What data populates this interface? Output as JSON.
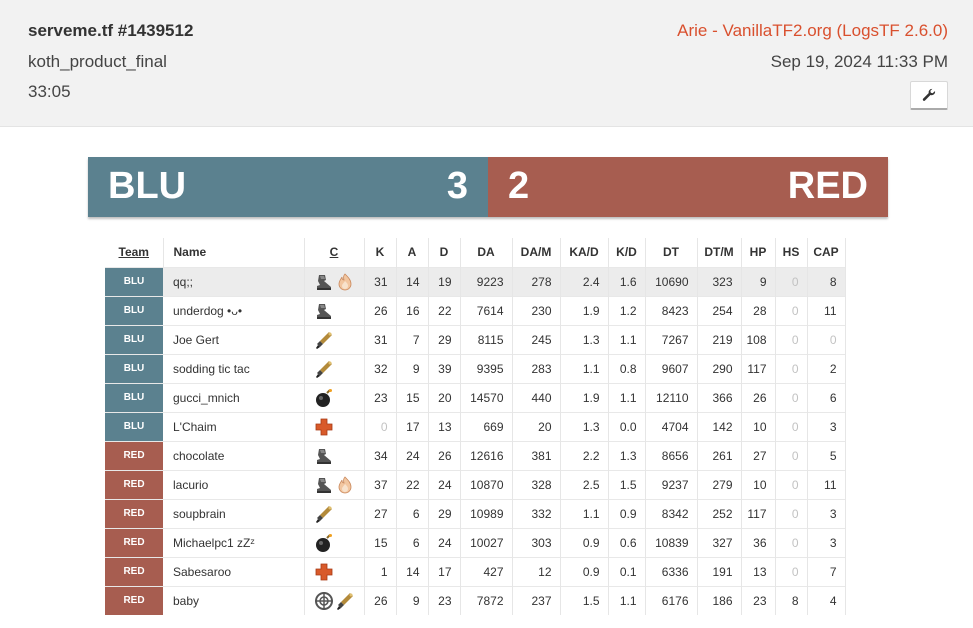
{
  "header": {
    "title": "serveme.tf #1439512",
    "map": "koth_product_final",
    "duration": "33:05",
    "uploader": "Arie - VanillaTF2.org (LogsTF 2.6.0)",
    "date": "Sep 19, 2024 11:33 PM",
    "tool_icon": "wrench-icon"
  },
  "score": {
    "blu_label": "BLU",
    "blu_score": "3",
    "red_score": "2",
    "red_label": "RED",
    "colors": {
      "blu": "#5b818f",
      "red": "#a75d50"
    }
  },
  "table": {
    "headers": [
      "Team",
      "Name",
      "C",
      "K",
      "A",
      "D",
      "DA",
      "DA/M",
      "KA/D",
      "K/D",
      "DT",
      "DT/M",
      "HP",
      "HS",
      "CAP"
    ],
    "rows": [
      {
        "team": "BLU",
        "name": "qq;;",
        "classes": [
          "scout-icon",
          "pyro-icon"
        ],
        "k": "31",
        "a": "14",
        "d": "19",
        "da": "9223",
        "dam": "278",
        "kad": "2.4",
        "kd": "1.6",
        "dt": "10690",
        "dtm": "323",
        "hp": "9",
        "hs": "0",
        "cap": "8"
      },
      {
        "team": "BLU",
        "name": "underdog •ᴗ•",
        "classes": [
          "scout-icon"
        ],
        "k": "26",
        "a": "16",
        "d": "22",
        "da": "7614",
        "dam": "230",
        "kad": "1.9",
        "kd": "1.2",
        "dt": "8423",
        "dtm": "254",
        "hp": "28",
        "hs": "0",
        "cap": "11"
      },
      {
        "team": "BLU",
        "name": "Joe Gert",
        "classes": [
          "soldier-icon"
        ],
        "k": "31",
        "a": "7",
        "d": "29",
        "da": "8115",
        "dam": "245",
        "kad": "1.3",
        "kd": "1.1",
        "dt": "7267",
        "dtm": "219",
        "hp": "108",
        "hs": "0",
        "cap": "0"
      },
      {
        "team": "BLU",
        "name": "sodding tic tac",
        "classes": [
          "soldier-icon"
        ],
        "k": "32",
        "a": "9",
        "d": "39",
        "da": "9395",
        "dam": "283",
        "kad": "1.1",
        "kd": "0.8",
        "dt": "9607",
        "dtm": "290",
        "hp": "117",
        "hs": "0",
        "cap": "2"
      },
      {
        "team": "BLU",
        "name": "gucci_mnich",
        "classes": [
          "demoman-icon"
        ],
        "k": "23",
        "a": "15",
        "d": "20",
        "da": "14570",
        "dam": "440",
        "kad": "1.9",
        "kd": "1.1",
        "dt": "12110",
        "dtm": "366",
        "hp": "26",
        "hs": "0",
        "cap": "6"
      },
      {
        "team": "BLU",
        "name": "L'Chaim",
        "classes": [
          "medic-icon"
        ],
        "k": "0",
        "a": "17",
        "d": "13",
        "da": "669",
        "dam": "20",
        "kad": "1.3",
        "kd": "0.0",
        "dt": "4704",
        "dtm": "142",
        "hp": "10",
        "hs": "0",
        "cap": "3"
      },
      {
        "team": "RED",
        "name": "chocolate",
        "classes": [
          "scout-icon"
        ],
        "k": "34",
        "a": "24",
        "d": "26",
        "da": "12616",
        "dam": "381",
        "kad": "2.2",
        "kd": "1.3",
        "dt": "8656",
        "dtm": "261",
        "hp": "27",
        "hs": "0",
        "cap": "5"
      },
      {
        "team": "RED",
        "name": "lacurio",
        "classes": [
          "scout-icon",
          "pyro-icon"
        ],
        "k": "37",
        "a": "22",
        "d": "24",
        "da": "10870",
        "dam": "328",
        "kad": "2.5",
        "kd": "1.5",
        "dt": "9237",
        "dtm": "279",
        "hp": "10",
        "hs": "0",
        "cap": "11"
      },
      {
        "team": "RED",
        "name": "soupbrain",
        "classes": [
          "soldier-icon"
        ],
        "k": "27",
        "a": "6",
        "d": "29",
        "da": "10989",
        "dam": "332",
        "kad": "1.1",
        "kd": "0.9",
        "dt": "8342",
        "dtm": "252",
        "hp": "117",
        "hs": "0",
        "cap": "3"
      },
      {
        "team": "RED",
        "name": "Michaelpc1 zZᶻ",
        "classes": [
          "demoman-icon"
        ],
        "k": "15",
        "a": "6",
        "d": "24",
        "da": "10027",
        "dam": "303",
        "kad": "0.9",
        "kd": "0.6",
        "dt": "10839",
        "dtm": "327",
        "hp": "36",
        "hs": "0",
        "cap": "3"
      },
      {
        "team": "RED",
        "name": "Sabesaroo",
        "classes": [
          "medic-icon"
        ],
        "k": "1",
        "a": "14",
        "d": "17",
        "da": "427",
        "dam": "12",
        "kad": "0.9",
        "kd": "0.1",
        "dt": "6336",
        "dtm": "191",
        "hp": "13",
        "hs": "0",
        "cap": "7"
      },
      {
        "team": "RED",
        "name": "baby",
        "classes": [
          "sniper-icon",
          "soldier-icon"
        ],
        "k": "26",
        "a": "9",
        "d": "23",
        "da": "7872",
        "dam": "237",
        "kad": "1.5",
        "kd": "1.1",
        "dt": "6176",
        "dtm": "186",
        "hp": "23",
        "hs": "8",
        "cap": "4"
      }
    ]
  }
}
